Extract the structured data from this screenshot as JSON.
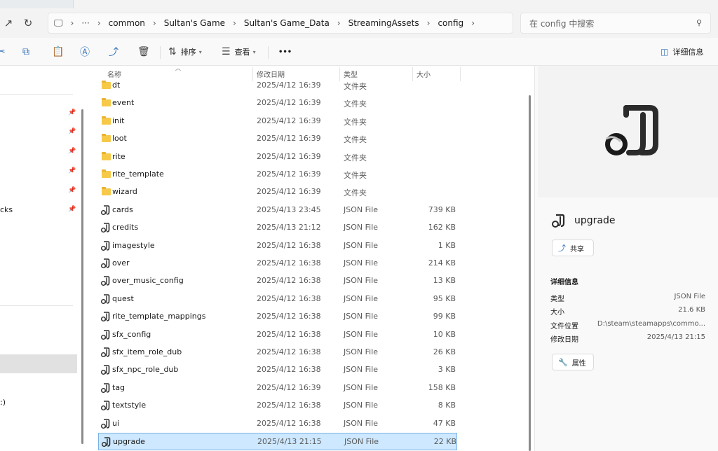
{
  "breadcrumb": [
    "common",
    "Sultan's Game",
    "Sultan's Game_Data",
    "StreamingAssets",
    "config"
  ],
  "search": {
    "placeholder": "在 config 中搜索"
  },
  "toolbar": {
    "sort_label": "排序",
    "view_label": "查看",
    "more": "•••",
    "details_label": "详细信息"
  },
  "columns": {
    "name": "名称",
    "date": "修改日期",
    "type": "类型",
    "size": "大小"
  },
  "nav": {
    "partial_label_1": "cks",
    "partial_label_2": ":)"
  },
  "files": [
    {
      "name": "dt",
      "date": "2025/4/12 16:39",
      "type": "文件夹",
      "size": "",
      "kind": "folder"
    },
    {
      "name": "event",
      "date": "2025/4/12 16:39",
      "type": "文件夹",
      "size": "",
      "kind": "folder"
    },
    {
      "name": "init",
      "date": "2025/4/12 16:39",
      "type": "文件夹",
      "size": "",
      "kind": "folder"
    },
    {
      "name": "loot",
      "date": "2025/4/12 16:39",
      "type": "文件夹",
      "size": "",
      "kind": "folder"
    },
    {
      "name": "rite",
      "date": "2025/4/12 16:39",
      "type": "文件夹",
      "size": "",
      "kind": "folder"
    },
    {
      "name": "rite_template",
      "date": "2025/4/12 16:39",
      "type": "文件夹",
      "size": "",
      "kind": "folder"
    },
    {
      "name": "wizard",
      "date": "2025/4/12 16:39",
      "type": "文件夹",
      "size": "",
      "kind": "folder"
    },
    {
      "name": "cards",
      "date": "2025/4/13 23:45",
      "type": "JSON File",
      "size": "739 KB",
      "kind": "json"
    },
    {
      "name": "credits",
      "date": "2025/4/13 21:12",
      "type": "JSON File",
      "size": "162 KB",
      "kind": "json"
    },
    {
      "name": "imagestyle",
      "date": "2025/4/12 16:38",
      "type": "JSON File",
      "size": "1 KB",
      "kind": "json"
    },
    {
      "name": "over",
      "date": "2025/4/12 16:38",
      "type": "JSON File",
      "size": "214 KB",
      "kind": "json"
    },
    {
      "name": "over_music_config",
      "date": "2025/4/12 16:38",
      "type": "JSON File",
      "size": "13 KB",
      "kind": "json"
    },
    {
      "name": "quest",
      "date": "2025/4/12 16:38",
      "type": "JSON File",
      "size": "95 KB",
      "kind": "json"
    },
    {
      "name": "rite_template_mappings",
      "date": "2025/4/12 16:38",
      "type": "JSON File",
      "size": "99 KB",
      "kind": "json"
    },
    {
      "name": "sfx_config",
      "date": "2025/4/12 16:38",
      "type": "JSON File",
      "size": "10 KB",
      "kind": "json"
    },
    {
      "name": "sfx_item_role_dub",
      "date": "2025/4/12 16:38",
      "type": "JSON File",
      "size": "26 KB",
      "kind": "json"
    },
    {
      "name": "sfx_npc_role_dub",
      "date": "2025/4/12 16:38",
      "type": "JSON File",
      "size": "3 KB",
      "kind": "json"
    },
    {
      "name": "tag",
      "date": "2025/4/12 16:39",
      "type": "JSON File",
      "size": "158 KB",
      "kind": "json"
    },
    {
      "name": "textstyle",
      "date": "2025/4/12 16:38",
      "type": "JSON File",
      "size": "8 KB",
      "kind": "json"
    },
    {
      "name": "ui",
      "date": "2025/4/12 16:38",
      "type": "JSON File",
      "size": "47 KB",
      "kind": "json"
    },
    {
      "name": "upgrade",
      "date": "2025/4/13 21:15",
      "type": "JSON File",
      "size": "22 KB",
      "kind": "json",
      "selected": true
    }
  ],
  "details": {
    "title": "upgrade",
    "share_label": "共享",
    "section_heading": "详细信息",
    "props_label": "属性",
    "rows": [
      {
        "label": "类型",
        "value": "JSON File"
      },
      {
        "label": "大小",
        "value": "21.6 KB"
      },
      {
        "label": "文件位置",
        "value": "D:\\steam\\steamapps\\commo..."
      },
      {
        "label": "修改日期",
        "value": "2025/4/13 21:15"
      }
    ]
  },
  "colors": {
    "accent": "#2f6fb5",
    "selection": "#cde8ff",
    "selection_border": "#7bb3e4",
    "folder": "#f7c948"
  }
}
